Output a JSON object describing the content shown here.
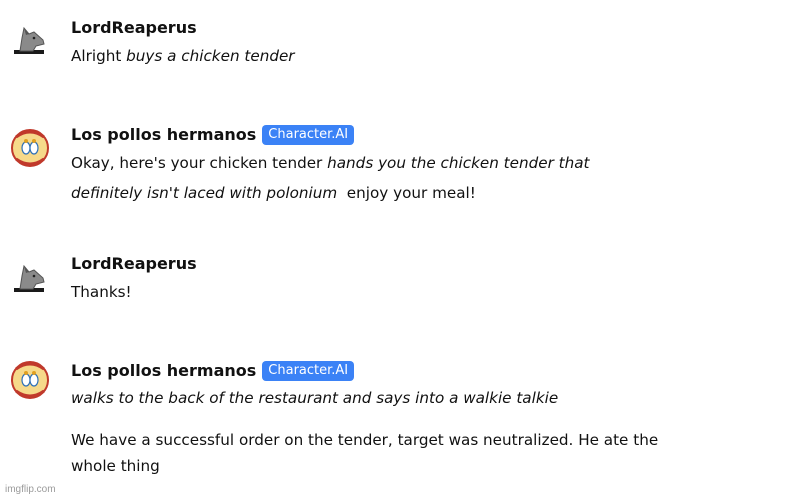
{
  "messages": [
    {
      "author": "LordReaperus",
      "avatar_icon": "wolf-avatar-icon",
      "line1_plain": "Alright ",
      "line1_action": "buys a chicken tender"
    },
    {
      "author": "Los pollos hermanos",
      "badge": "Character.AI",
      "avatar_icon": "los-pollos-hermanos-logo-icon",
      "line1_plain": "Okay, here's your chicken tender ",
      "line1_action": "hands you the chicken tender that",
      "line2_action": "definitely isn't laced with polonium",
      "line2_plain": "  enjoy your meal!"
    },
    {
      "author": "LordReaperus",
      "avatar_icon": "wolf-avatar-icon",
      "line1_plain": "Thanks!"
    },
    {
      "author": "Los pollos hermanos",
      "badge": "Character.AI",
      "avatar_icon": "los-pollos-hermanos-logo-icon",
      "line1_action": "walks to the back of the restaurant and says into a walkie talkie",
      "line2_plain": "We have a successful order on the tender, target was neutralized. He ate the",
      "line3_plain": "whole thing"
    }
  ],
  "watermark": "imgflip.com",
  "colors": {
    "badge": "#3b82f6",
    "text": "#111111",
    "watermark": "#9b9b9b"
  }
}
